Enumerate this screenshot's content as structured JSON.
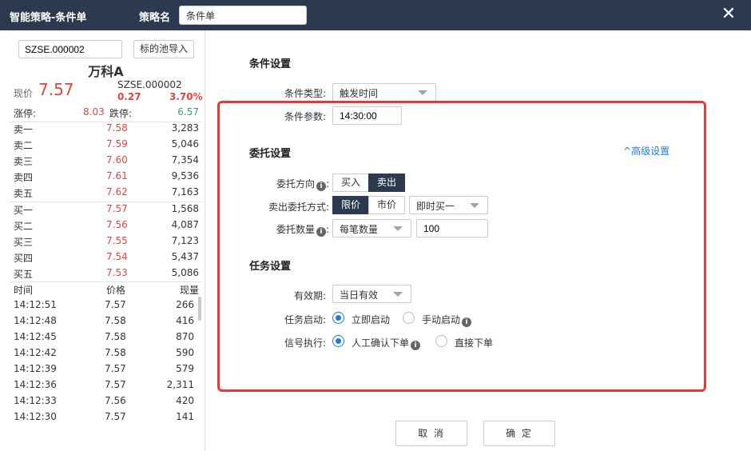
{
  "titlebar": {
    "app_title": "智能策略-条件单",
    "strategy_label": "策略名",
    "strategy_name": "条件单"
  },
  "stock": {
    "code_input": "SZSE.000002",
    "pool_button": "标的池导入",
    "name": "万科A",
    "price_label": "现价",
    "price": "7.57",
    "code": "SZSE.000002",
    "change": "0.27",
    "change_pct": "3.70%",
    "limit_up_label": "涨停:",
    "limit_up": "8.03",
    "limit_down_label": "跌停:",
    "limit_down": "6.57"
  },
  "orderbook": {
    "asks": [
      {
        "label": "卖一",
        "price": "7.58",
        "vol": "3,283"
      },
      {
        "label": "卖二",
        "price": "7.59",
        "vol": "5,046"
      },
      {
        "label": "卖三",
        "price": "7.60",
        "vol": "7,354"
      },
      {
        "label": "卖四",
        "price": "7.61",
        "vol": "9,536"
      },
      {
        "label": "卖五",
        "price": "7.62",
        "vol": "7,163"
      }
    ],
    "bids": [
      {
        "label": "买一",
        "price": "7.57",
        "vol": "1,568"
      },
      {
        "label": "买二",
        "price": "7.56",
        "vol": "4,087"
      },
      {
        "label": "买三",
        "price": "7.55",
        "vol": "7,123"
      },
      {
        "label": "买四",
        "price": "7.54",
        "vol": "5,437"
      },
      {
        "label": "买五",
        "price": "7.53",
        "vol": "5,086"
      }
    ]
  },
  "ticks": {
    "headers": [
      "时间",
      "价格",
      "现量"
    ],
    "rows": [
      {
        "time": "14:12:51",
        "price": "7.57",
        "vol": "266"
      },
      {
        "time": "14:12:48",
        "price": "7.58",
        "vol": "416"
      },
      {
        "time": "14:12:45",
        "price": "7.58",
        "vol": "870"
      },
      {
        "time": "14:12:42",
        "price": "7.58",
        "vol": "590"
      },
      {
        "time": "14:12:39",
        "price": "7.57",
        "vol": "579"
      },
      {
        "time": "14:12:36",
        "price": "7.57",
        "vol": "2,311"
      },
      {
        "time": "14:12:33",
        "price": "7.56",
        "vol": "420"
      },
      {
        "time": "14:12:30",
        "price": "7.57",
        "vol": "141"
      }
    ]
  },
  "condition": {
    "title": "条件设置",
    "type_label": "条件类型:",
    "type_value": "触发时间",
    "param_label": "条件参数:",
    "param_value": "14:30:00"
  },
  "order": {
    "title": "委托设置",
    "advanced": "高级设置",
    "direction_label": "委托方向",
    "buy": "买入",
    "sell": "卖出",
    "method_label": "卖出委托方式:",
    "limit": "限价",
    "market": "市价",
    "method_select": "即时买一",
    "qty_label": "委托数量",
    "qty_select": "每笔数量",
    "qty_value": "100"
  },
  "task": {
    "title": "任务设置",
    "valid_label": "有效期:",
    "valid_value": "当日有效",
    "start_label": "任务启动:",
    "start_now": "立即启动",
    "start_manual": "手动启动",
    "signal_label": "信号执行:",
    "signal_confirm": "人工确认下单",
    "signal_direct": "直接下单"
  },
  "buttons": {
    "cancel": "取 消",
    "ok": "确 定"
  },
  "colors": {
    "header": "#2b3a4e",
    "up": "#e64340",
    "down": "#2aa77a",
    "highlight_box": "#e8393a",
    "link": "#1e7bd8"
  }
}
